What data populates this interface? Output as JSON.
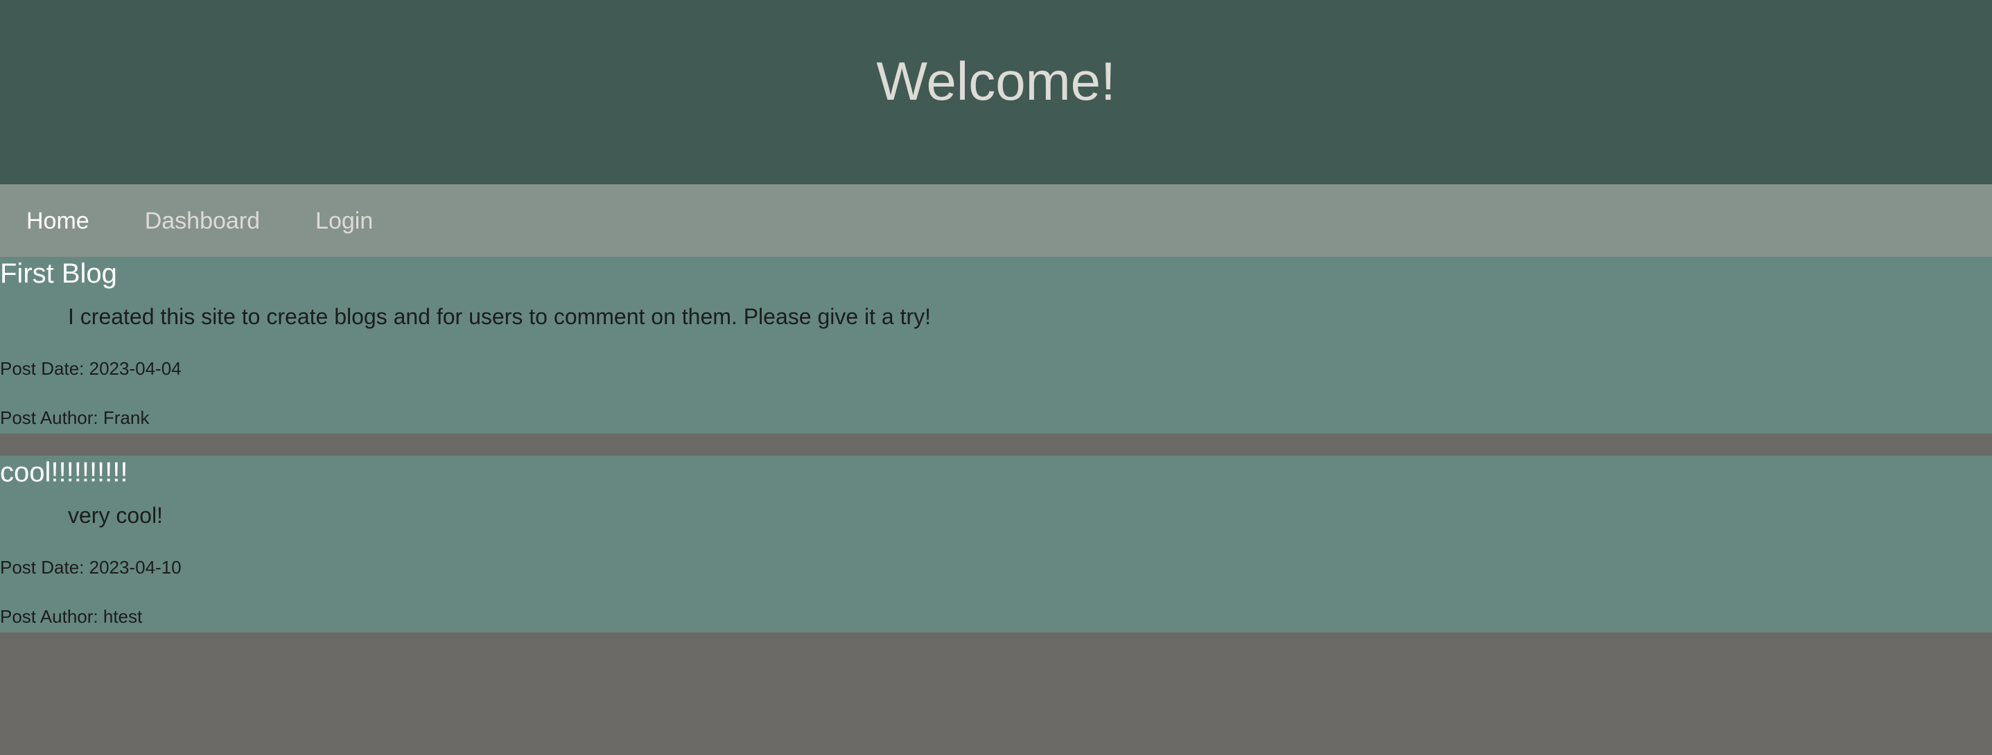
{
  "header": {
    "title": "Welcome!"
  },
  "nav": {
    "items": [
      {
        "label": "Home"
      },
      {
        "label": "Dashboard"
      },
      {
        "label": "Login"
      }
    ]
  },
  "posts": [
    {
      "title": "First Blog",
      "body": "I created this site to create blogs and for users to comment on them. Please give it a try!",
      "date": "Post Date: 2023-04-04",
      "author": "Post Author: Frank"
    },
    {
      "title": "cool!!!!!!!!!!",
      "body": "very cool!",
      "date": "Post Date: 2023-04-10",
      "author": "Post Author: htest"
    }
  ],
  "colors": {
    "header_bg": "#415a53",
    "nav_bg": "#86928c",
    "post_bg": "#668881",
    "page_bg": "#6b6a66"
  }
}
